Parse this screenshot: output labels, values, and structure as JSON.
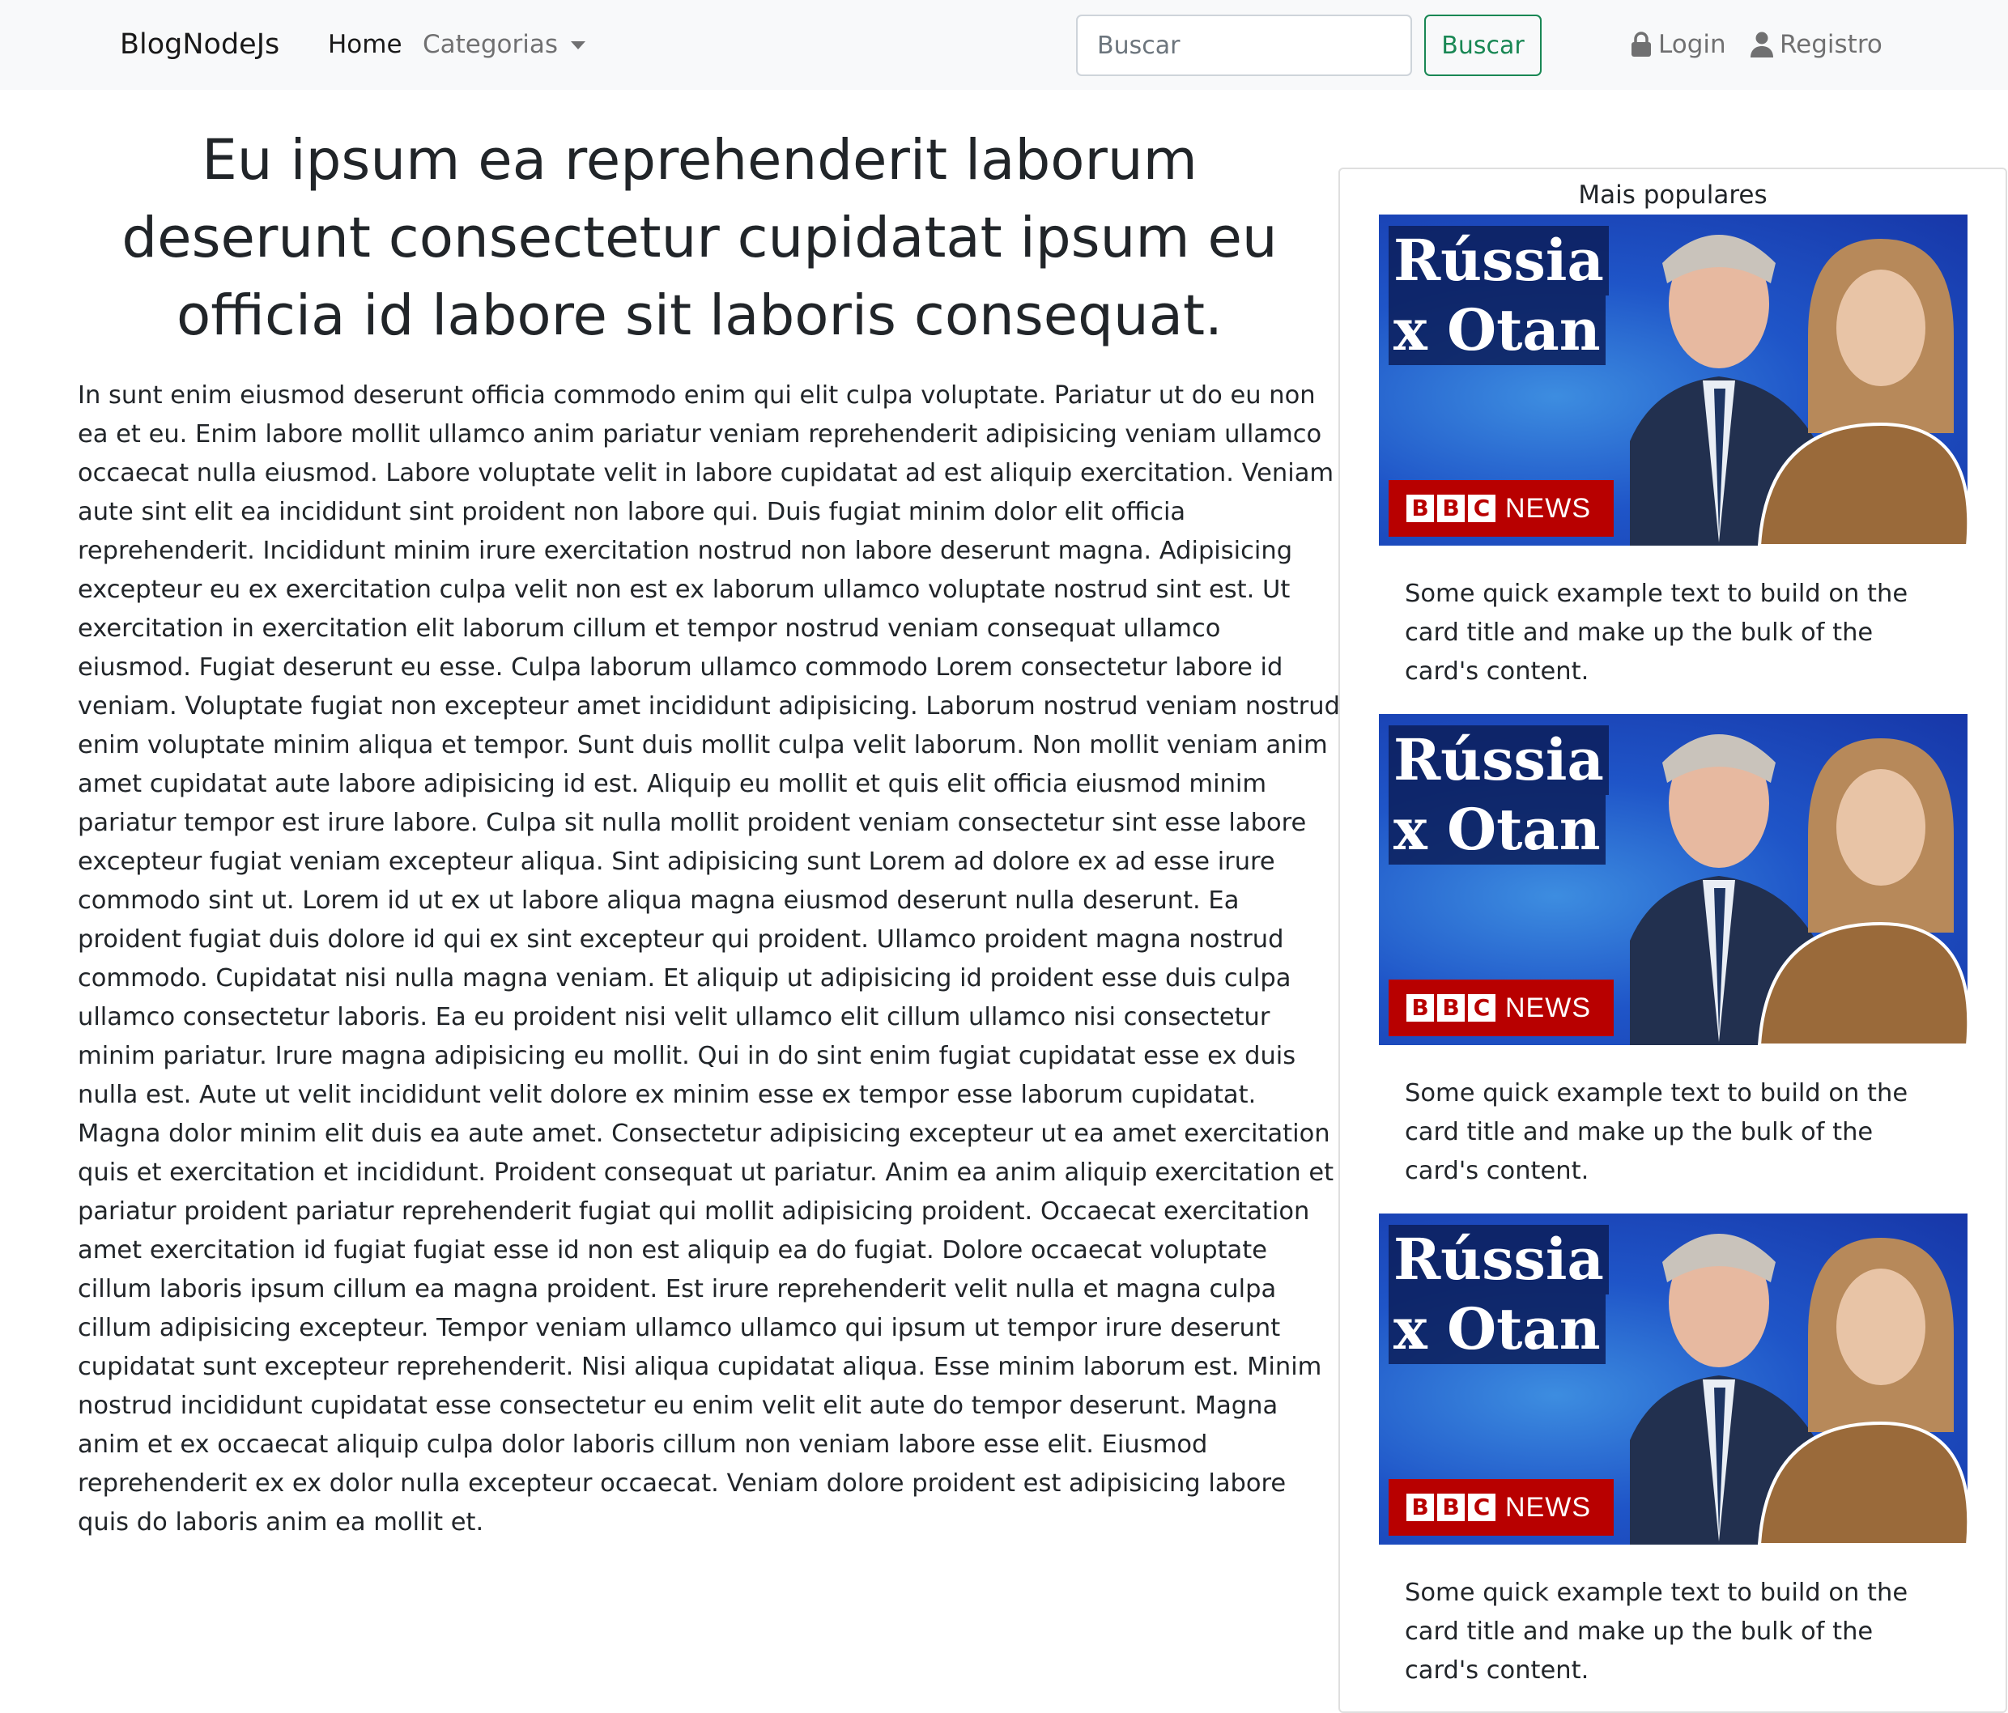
{
  "navbar": {
    "brand": "BlogNodeJs",
    "home_label": "Home",
    "categorias_label": "Categorias",
    "search_placeholder": "Buscar",
    "search_button_label": "Buscar",
    "login_label": "Login",
    "registro_label": "Registro",
    "icons": {
      "login": "lock-icon",
      "registro": "user-icon",
      "dropdown": "caret-down-icon"
    }
  },
  "article": {
    "title": "Eu ipsum ea reprehenderit laborum deserunt consectetur cupidatat ipsum eu officia id labore sit laboris consequat.",
    "body": "In sunt enim eiusmod deserunt officia commodo enim qui elit culpa voluptate. Pariatur ut do eu non ea et eu. Enim labore mollit ullamco anim pariatur veniam reprehenderit adipisicing veniam ullamco occaecat nulla eiusmod. Labore voluptate velit in labore cupidatat ad est aliquip exercitation. Veniam aute sint elit ea incididunt sint proident non labore qui. Duis fugiat minim dolor elit officia reprehenderit. Incididunt minim irure exercitation nostrud non labore deserunt magna. Adipisicing excepteur eu ex exercitation culpa velit non est ex laborum ullamco voluptate nostrud sint est. Ut exercitation in exercitation elit laborum cillum et tempor nostrud veniam consequat ullamco eiusmod. Fugiat deserunt eu esse. Culpa laborum ullamco commodo Lorem consectetur labore id veniam. Voluptate fugiat non excepteur amet incididunt adipisicing. Laborum nostrud veniam nostrud enim voluptate minim aliqua et tempor. Sunt duis mollit culpa velit laborum. Non mollit veniam anim amet cupidatat aute labore adipisicing id est. Aliquip eu mollit et quis elit officia eiusmod minim pariatur tempor est irure labore. Culpa sit nulla mollit proident veniam consectetur sint esse labore excepteur fugiat veniam excepteur aliqua. Sint adipisicing sunt Lorem ad dolore ex ad esse irure commodo sint ut. Lorem id ut ex ut labore aliqua magna eiusmod deserunt nulla deserunt. Ea proident fugiat duis dolore id qui ex sint excepteur qui proident. Ullamco proident magna nostrud commodo. Cupidatat nisi nulla magna veniam. Et aliquip ut adipisicing id proident esse duis culpa ullamco consectetur laboris. Ea eu proident nisi velit ullamco elit cillum ullamco nisi consectetur minim pariatur. Irure magna adipisicing eu mollit. Qui in do sint enim fugiat cupidatat esse ex duis nulla est. Aute ut velit incididunt velit dolore ex minim esse ex tempor esse laborum cupidatat. Magna dolor minim elit duis ea aute amet. Consectetur adipisicing excepteur ut ea amet exercitation quis et exercitation et incididunt. Proident consequat ut pariatur. Anim ea anim aliquip exercitation et pariatur proident pariatur reprehenderit fugiat qui mollit adipisicing proident. Occaecat exercitation amet exercitation id fugiat fugiat esse id non est aliquip ea do fugiat. Dolore occaecat voluptate cillum laboris ipsum cillum ea magna proident. Est irure reprehenderit velit nulla et magna culpa cillum adipisicing excepteur. Tempor veniam ullamco ullamco qui ipsum ut tempor irure deserunt cupidatat sunt excepteur reprehenderit. Nisi aliqua cupidatat aliqua. Esse minim laborum est. Minim nostrud incididunt cupidatat esse consectetur eu enim velit elit aute do tempor deserunt. Magna anim et ex occaecat aliquip culpa dolor laboris cillum non veniam labore esse elit. Eiusmod reprehenderit ex ex dolor nulla excepteur occaecat. Veniam dolore proident est adipisicing labore quis do laboris anim ea mollit et."
  },
  "sidebar": {
    "title": "Mais populares",
    "cards": [
      {
        "thumb_line1": "Rússia",
        "thumb_line2": "x Otan",
        "thumb_brand": "BBC",
        "thumb_brand_suffix": "NEWS",
        "text": "Some quick example text to build on the card title and make up the bulk of the card's content."
      },
      {
        "thumb_line1": "Rússia",
        "thumb_line2": "x Otan",
        "thumb_brand": "BBC",
        "thumb_brand_suffix": "NEWS",
        "text": "Some quick example text to build on the card title and make up the bulk of the card's content."
      },
      {
        "thumb_line1": "Rússia",
        "thumb_line2": "x Otan",
        "thumb_brand": "BBC",
        "thumb_brand_suffix": "NEWS",
        "text": "Some quick example text to build on the card title and make up the bulk of the card's content."
      }
    ]
  },
  "colors": {
    "navbar_bg": "#f8f9fa",
    "success": "#198754",
    "text": "#212529",
    "muted": "#6c757d",
    "bbc_red": "#b80000"
  }
}
